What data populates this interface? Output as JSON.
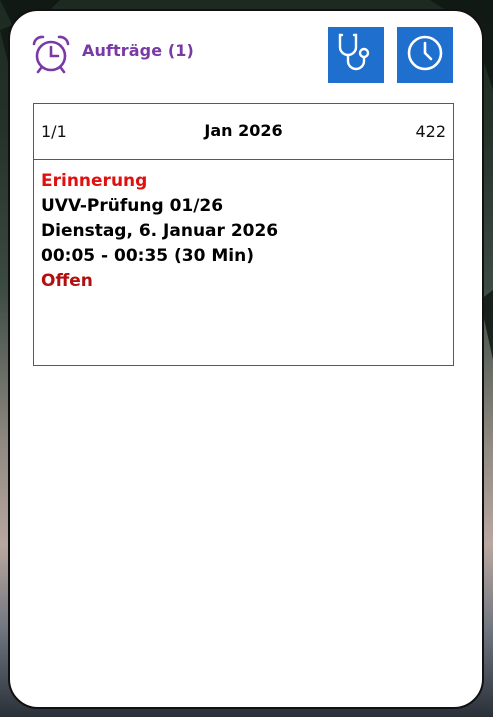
{
  "header": {
    "title": "Aufträge (1)",
    "icons": [
      "alarm-clock-icon",
      "stethoscope-icon",
      "clock-icon"
    ],
    "accent_color": "#7a3aa6",
    "button_color": "#1f6fcf"
  },
  "entry": {
    "pager": "1/1",
    "month": "Jan 2026",
    "number": "422",
    "type": "Erinnerung",
    "subject": "UVV-Prüfung 01/26",
    "date": "Dienstag, 6. Januar 2026",
    "time": "00:05 - 00:35 (30 Min)",
    "status": "Offen",
    "type_color": "#e01010",
    "status_color": "#b01010"
  }
}
